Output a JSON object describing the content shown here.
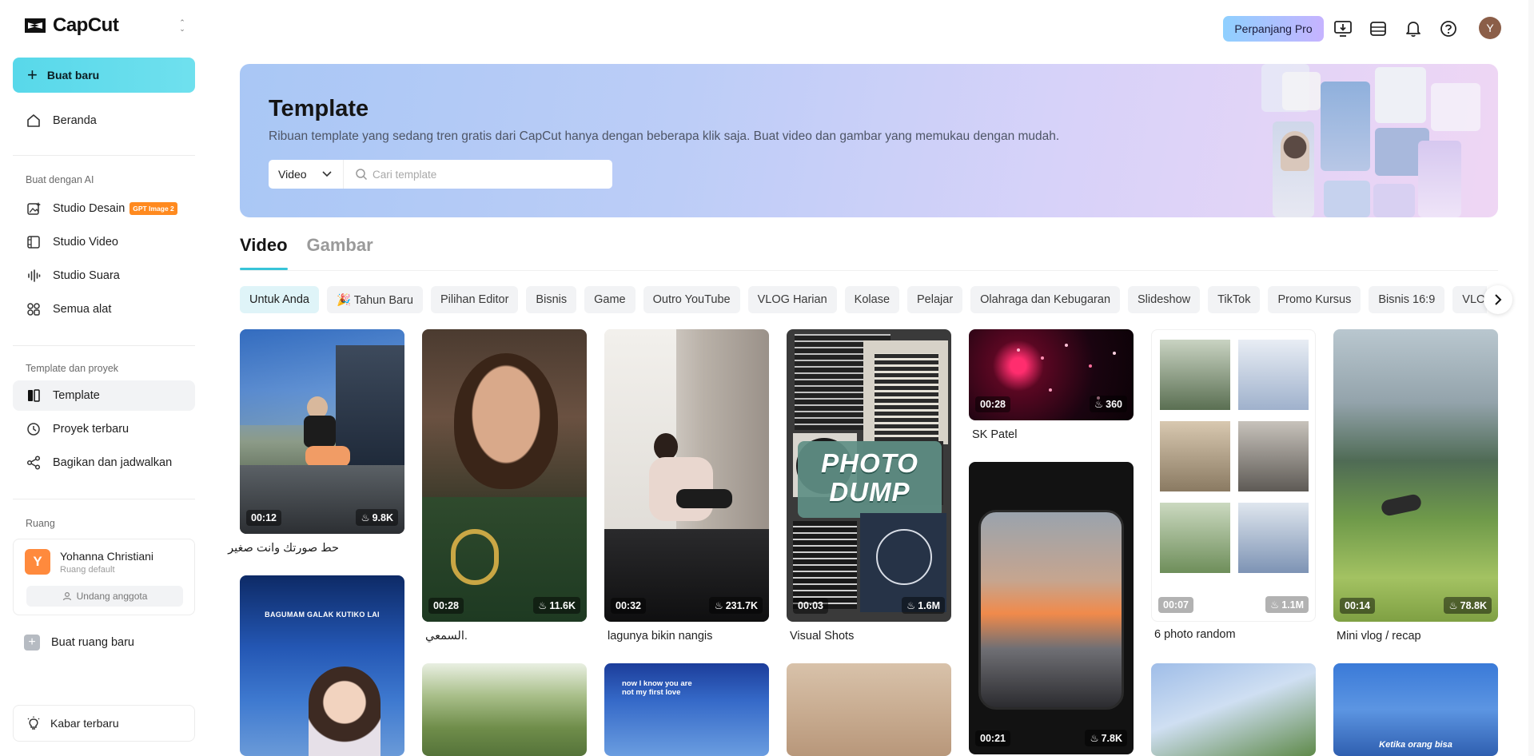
{
  "brand": {
    "name": "CapCut"
  },
  "sidebar": {
    "new_button": "Buat baru",
    "home": "Beranda",
    "ai_section_label": "Buat dengan AI",
    "ai_items": [
      {
        "label": "Studio Desain",
        "badge": "GPT Image 2"
      },
      {
        "label": "Studio Video"
      },
      {
        "label": "Studio Suara"
      },
      {
        "label": "Semua alat"
      }
    ],
    "projects_section_label": "Template dan proyek",
    "project_items": [
      {
        "label": "Template"
      },
      {
        "label": "Proyek terbaru"
      },
      {
        "label": "Bagikan dan jadwalkan"
      }
    ],
    "space_section_label": "Ruang",
    "space": {
      "avatar_letter": "Y",
      "name": "Yohanna Christiani",
      "subtitle": "Ruang default",
      "invite_label": "Undang anggota"
    },
    "new_space": "Buat ruang baru",
    "news": "Kabar terbaru"
  },
  "topbar": {
    "pro_button": "Perpanjang Pro",
    "avatar_letter": "Y"
  },
  "hero": {
    "title": "Template",
    "subtitle": "Ribuan template yang sedang tren gratis dari CapCut hanya dengan beberapa klik saja. Buat video dan gambar yang memukau dengan mudah.",
    "select_value": "Video",
    "search_placeholder": "Cari template"
  },
  "tabs": [
    {
      "label": "Video",
      "active": true
    },
    {
      "label": "Gambar",
      "active": false
    }
  ],
  "chips": [
    "Untuk Anda",
    "🎉 Tahun Baru",
    "Pilihan Editor",
    "Bisnis",
    "Game",
    "Outro YouTube",
    "VLOG Harian",
    "Kolase",
    "Pelajar",
    "Olahraga dan Kebugaran",
    "Slideshow",
    "TikTok",
    "Promo Kursus",
    "Bisnis 16:9",
    "VLOG"
  ],
  "templates": [
    {
      "duration": "00:12",
      "uses": "9.8K",
      "caption": "حط صورتك وانت صغير"
    },
    {
      "duration": "00:28",
      "uses": "11.6K",
      "caption": "السمعي."
    },
    {
      "duration": "00:32",
      "uses": "231.7K",
      "caption": "lagunya bikin nangis"
    },
    {
      "duration": "00:03",
      "uses": "1.6M",
      "caption": "Visual Shots",
      "overlay": "PHOTO DUMP"
    },
    {
      "duration": "00:28",
      "uses": "360",
      "caption": "SK Patel"
    },
    {
      "duration": "00:07",
      "uses": "1.1M",
      "caption": "6 photo random"
    },
    {
      "duration": "00:14",
      "uses": "78.8K",
      "caption": "Mini vlog / recap"
    },
    {
      "duration": "00:21",
      "uses": "7.8K",
      "caption": ""
    }
  ],
  "thumb_texts": {
    "bagumam": "BAGUMAM GALAK KUTIKO LAI",
    "love": "now I know you are not my first love",
    "ketika": "Ketika orang bisa"
  },
  "colors": {
    "accent": "#37c4d8",
    "new_button": "#58d8ea",
    "gpt_badge": "#ff8a1f",
    "space_avatar": "#ff8a3d"
  }
}
